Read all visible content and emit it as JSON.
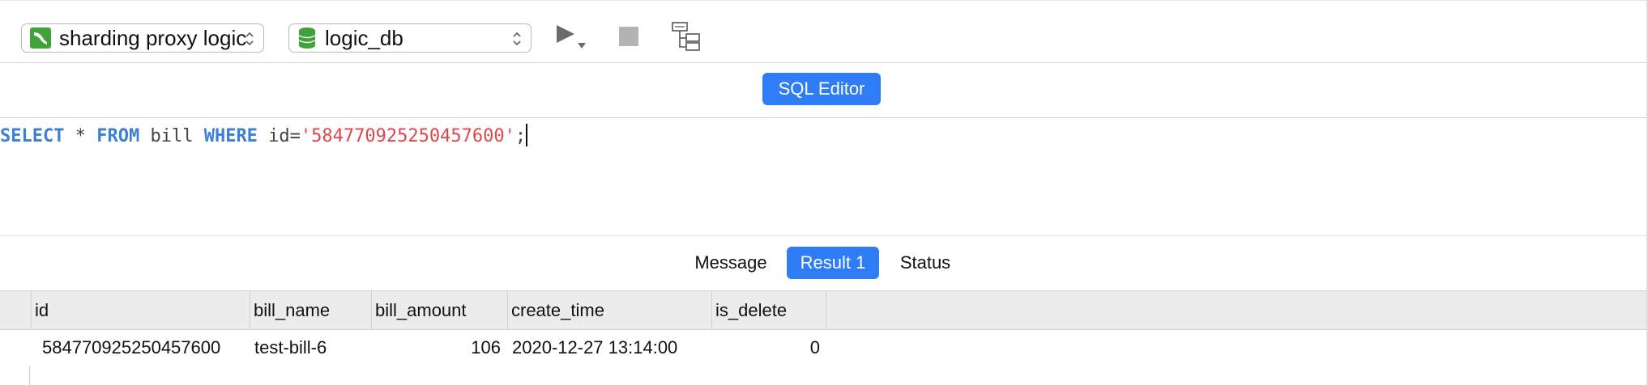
{
  "toolbar": {
    "connection": "sharding proxy logic",
    "database": "logic_db"
  },
  "editor": {
    "tab_label": "SQL Editor",
    "query": {
      "kw_select": "SELECT",
      "star": " * ",
      "kw_from": "FROM",
      "table": " bill ",
      "kw_where": "WHERE",
      "cond": " id=",
      "value": "'584770925250457600'",
      "end": ";"
    }
  },
  "results": {
    "tabs": [
      {
        "label": "Message",
        "active": false
      },
      {
        "label": "Result 1",
        "active": true
      },
      {
        "label": "Status",
        "active": false
      }
    ],
    "columns": [
      "id",
      "bill_name",
      "bill_amount",
      "create_time",
      "is_delete"
    ],
    "rows": [
      [
        "584770925250457600",
        "test-bill-6",
        "106",
        "2020-12-27 13:14:00",
        "0"
      ]
    ]
  },
  "colors": {
    "accent": "#2f7df6",
    "keyword": "#3b7fd6",
    "string": "#e0454b",
    "connection_icon": "#3fa33a"
  }
}
